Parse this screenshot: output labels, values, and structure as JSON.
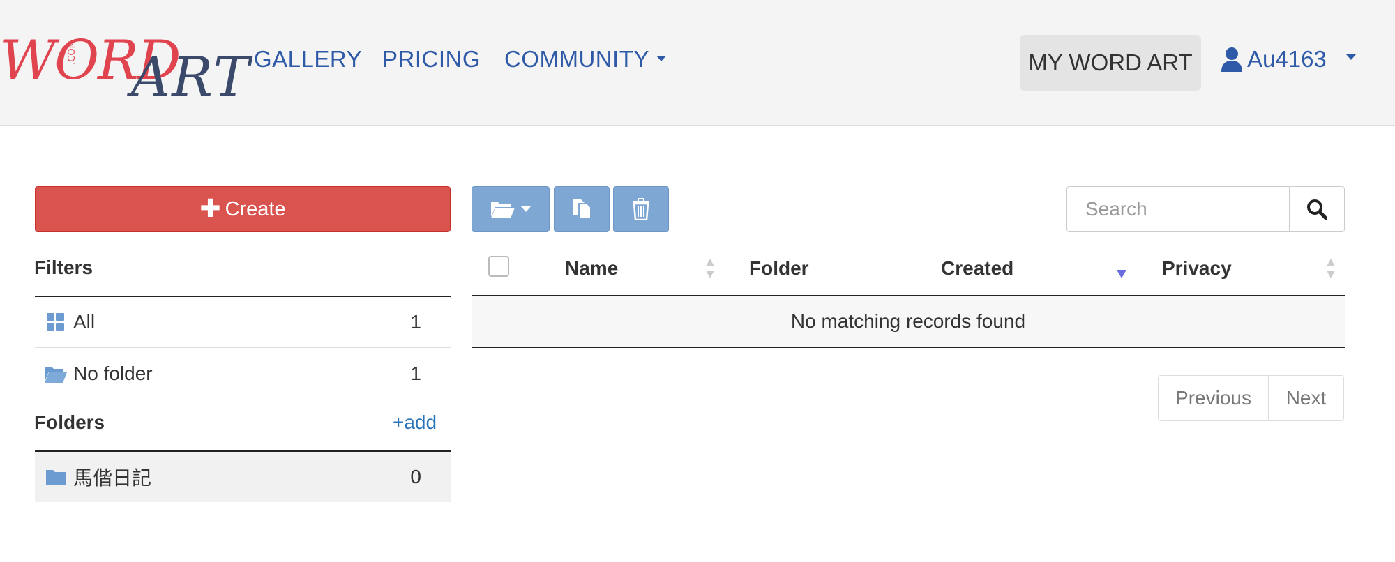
{
  "header": {
    "logo": {
      "word": "WORD",
      "com": ".COM",
      "art": "ART"
    },
    "nav": [
      {
        "label": "GALLERY"
      },
      {
        "label": "PRICING"
      },
      {
        "label": "COMMUNITY"
      }
    ],
    "my_word_art": "MY WORD ART",
    "username": "Au4163"
  },
  "sidebar": {
    "create_label": "Create",
    "filters_title": "Filters",
    "filters": [
      {
        "label": "All",
        "count": "1",
        "icon": "grid-icon"
      },
      {
        "label": "No folder",
        "count": "1",
        "icon": "folder-open-icon"
      }
    ],
    "folders_title": "Folders",
    "add_label": "+add",
    "folders": [
      {
        "label": "馬偕日記",
        "count": "0",
        "icon": "folder-icon"
      }
    ]
  },
  "toolbar": {
    "buttons": [
      {
        "icon": "folder-open-icon"
      },
      {
        "icon": "copy-icon"
      },
      {
        "icon": "trash-icon"
      }
    ]
  },
  "search": {
    "placeholder": "Search"
  },
  "table": {
    "columns": [
      "Name",
      "Folder",
      "Created",
      "Privacy"
    ],
    "empty_message": "No matching records found",
    "sort": {
      "column": "Created",
      "direction": "desc"
    }
  },
  "pagination": {
    "previous": "Previous",
    "next": "Next"
  },
  "colors": {
    "brand_red": "#d9534f",
    "link_blue": "#2f5aa8",
    "toolbar_blue": "#7ea7d4",
    "logo_red": "#e0454f",
    "logo_navy": "#3b4a6b"
  }
}
